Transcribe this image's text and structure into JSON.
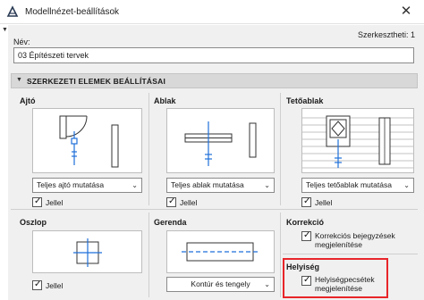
{
  "window": {
    "title": "Modellnézet-beállítások"
  },
  "editors": "Szerkesztheti: 1",
  "name": {
    "label": "Név:",
    "value": "03 Építészeti tervek"
  },
  "section": {
    "title": "SZERKEZETI ELEMEK BEÁLLÍTÁSAI"
  },
  "door": {
    "label": "Ajtó",
    "dropdown": "Teljes ajtó mutatása",
    "checkbox_label": "Jellel",
    "checked": true
  },
  "window_el": {
    "label": "Ablak",
    "dropdown": "Teljes ablak mutatása",
    "checkbox_label": "Jellel",
    "checked": true
  },
  "skylight": {
    "label": "Tetőablak",
    "dropdown": "Teljes tetőablak mutatása",
    "checkbox_label": "Jellel",
    "checked": true
  },
  "column": {
    "label": "Oszlop",
    "checkbox_label": "Jellel",
    "checked": true
  },
  "beam": {
    "label": "Gerenda",
    "dropdown": "Kontúr és tengely"
  },
  "correction": {
    "label": "Korrekció",
    "checkbox_line1": "Korrekciós bejegyzések",
    "checkbox_line2": "megjelenítése",
    "checked": true
  },
  "zone": {
    "label": "Helyiség",
    "checkbox_line1": "Helyiségpecsétek",
    "checkbox_line2": "megjelenítése",
    "checked": true
  },
  "colors": {
    "highlight": "#e8252a",
    "accent_blue": "#1e6fd9",
    "dialog_bg": "#f0f0f0"
  }
}
